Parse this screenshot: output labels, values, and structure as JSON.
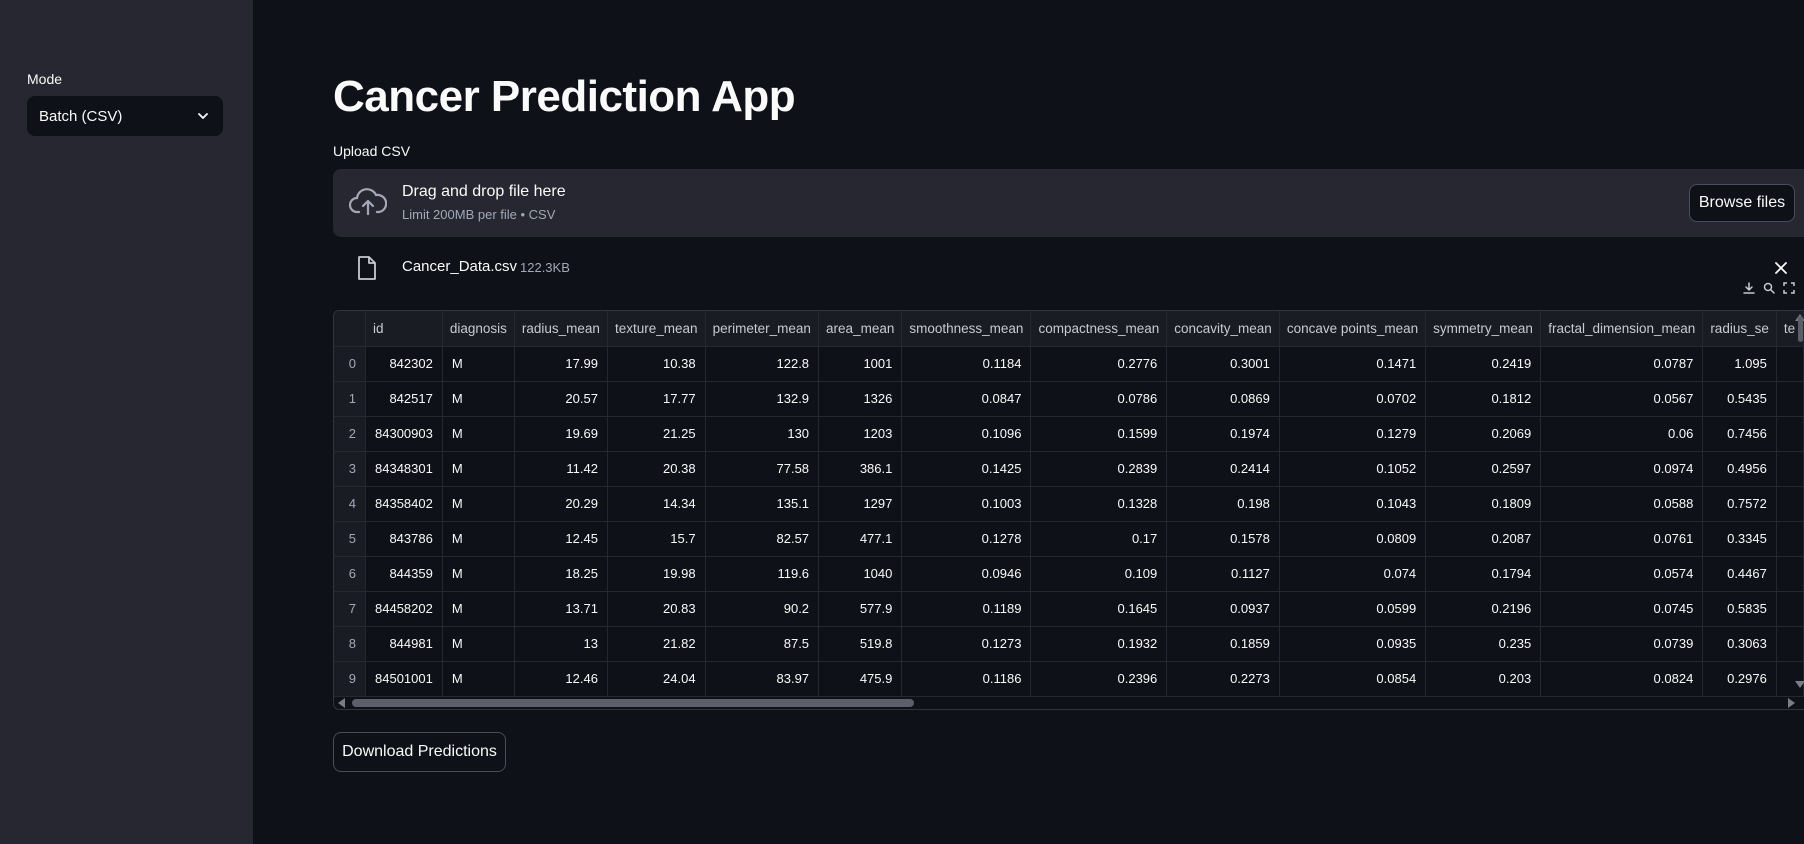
{
  "sidebar": {
    "mode_label": "Mode",
    "mode_value": "Batch (CSV)"
  },
  "main": {
    "title": "Cancer Prediction App",
    "upload_label": "Upload CSV",
    "dropzone": {
      "title": "Drag and drop file here",
      "subtitle": "Limit 200MB per file • CSV",
      "browse_label": "Browse files"
    },
    "file": {
      "name": "Cancer_Data.csv",
      "size": "122.3KB"
    },
    "download_label": "Download Predictions"
  },
  "table": {
    "columns": [
      "",
      "id",
      "diagnosis",
      "radius_mean",
      "texture_mean",
      "perimeter_mean",
      "area_mean",
      "smoothness_mean",
      "compactness_mean",
      "concavity_mean",
      "concave points_mean",
      "symmetry_mean",
      "fractal_dimension_mean",
      "radius_se",
      "te"
    ],
    "rows": [
      [
        "0",
        "842302",
        "M",
        "17.99",
        "10.38",
        "122.8",
        "1001",
        "0.1184",
        "0.2776",
        "0.3001",
        "0.1471",
        "0.2419",
        "0.0787",
        "1.095"
      ],
      [
        "1",
        "842517",
        "M",
        "20.57",
        "17.77",
        "132.9",
        "1326",
        "0.0847",
        "0.0786",
        "0.0869",
        "0.0702",
        "0.1812",
        "0.0567",
        "0.5435"
      ],
      [
        "2",
        "84300903",
        "M",
        "19.69",
        "21.25",
        "130",
        "1203",
        "0.1096",
        "0.1599",
        "0.1974",
        "0.1279",
        "0.2069",
        "0.06",
        "0.7456"
      ],
      [
        "3",
        "84348301",
        "M",
        "11.42",
        "20.38",
        "77.58",
        "386.1",
        "0.1425",
        "0.2839",
        "0.2414",
        "0.1052",
        "0.2597",
        "0.0974",
        "0.4956"
      ],
      [
        "4",
        "84358402",
        "M",
        "20.29",
        "14.34",
        "135.1",
        "1297",
        "0.1003",
        "0.1328",
        "0.198",
        "0.1043",
        "0.1809",
        "0.0588",
        "0.7572"
      ],
      [
        "5",
        "843786",
        "M",
        "12.45",
        "15.7",
        "82.57",
        "477.1",
        "0.1278",
        "0.17",
        "0.1578",
        "0.0809",
        "0.2087",
        "0.0761",
        "0.3345"
      ],
      [
        "6",
        "844359",
        "M",
        "18.25",
        "19.98",
        "119.6",
        "1040",
        "0.0946",
        "0.109",
        "0.1127",
        "0.074",
        "0.1794",
        "0.0574",
        "0.4467"
      ],
      [
        "7",
        "84458202",
        "M",
        "13.71",
        "20.83",
        "90.2",
        "577.9",
        "0.1189",
        "0.1645",
        "0.0937",
        "0.0599",
        "0.2196",
        "0.0745",
        "0.5835"
      ],
      [
        "8",
        "844981",
        "M",
        "13",
        "21.82",
        "87.5",
        "519.8",
        "0.1273",
        "0.1932",
        "0.1859",
        "0.0935",
        "0.235",
        "0.0739",
        "0.3063"
      ],
      [
        "9",
        "84501001",
        "M",
        "12.46",
        "24.04",
        "83.97",
        "475.9",
        "0.1186",
        "0.2396",
        "0.2273",
        "0.0854",
        "0.203",
        "0.0824",
        "0.2976"
      ]
    ]
  },
  "icons": {
    "mode_chevron": "chevron-down-icon",
    "upload": "cloud-upload-icon",
    "file": "file-icon",
    "close": "close-icon",
    "download": "download-icon",
    "search": "search-icon",
    "fullscreen": "fullscreen-icon"
  }
}
